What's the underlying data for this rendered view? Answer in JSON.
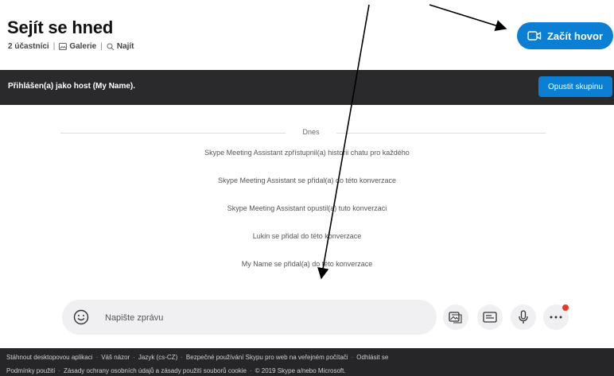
{
  "header": {
    "title": "Sejít se hned",
    "participants": "2 účastníci",
    "gallery": "Galerie",
    "find": "Najít",
    "call_button": "Začít hovor"
  },
  "banner": {
    "text": "Přihlášen(a) jako host (My Name).",
    "leave_button": "Opustit skupinu"
  },
  "chat": {
    "date_label": "Dnes",
    "messages": [
      "Skype Meeting Assistant zpřístupnil(a) historii chatu pro každého",
      "Skype Meeting Assistant se přidal(a) do této konverzace",
      "Skype Meeting Assistant opustil(a) tuto konverzaci",
      "Lukin se přidal do této konverzace",
      "My Name se přidal(a) do této konverzace"
    ]
  },
  "composer": {
    "placeholder": "Napište zprávu"
  },
  "footer": {
    "row1": [
      "Stáhnout desktopovou aplikaci",
      "Váš názor",
      "Jazyk (cs-CZ)",
      "Bezpečné používání Skypu pro web na veřejném počítači",
      "Odhlásit se"
    ],
    "row2": [
      "Podmínky použití",
      "Zásady ochrany osobních údajů a zásady použití souborů cookie",
      "© 2019 Skype a/nebo Microsoft."
    ]
  },
  "colors": {
    "accent": "#0a7fd3",
    "banner": "#2a2a2d",
    "footer": "#262629",
    "notification": "#e8392b"
  },
  "icons": [
    "gallery-icon",
    "search-icon",
    "video-call-icon",
    "emoji-icon",
    "media-gallery-icon",
    "contact-card-icon",
    "microphone-icon",
    "more-icon"
  ]
}
